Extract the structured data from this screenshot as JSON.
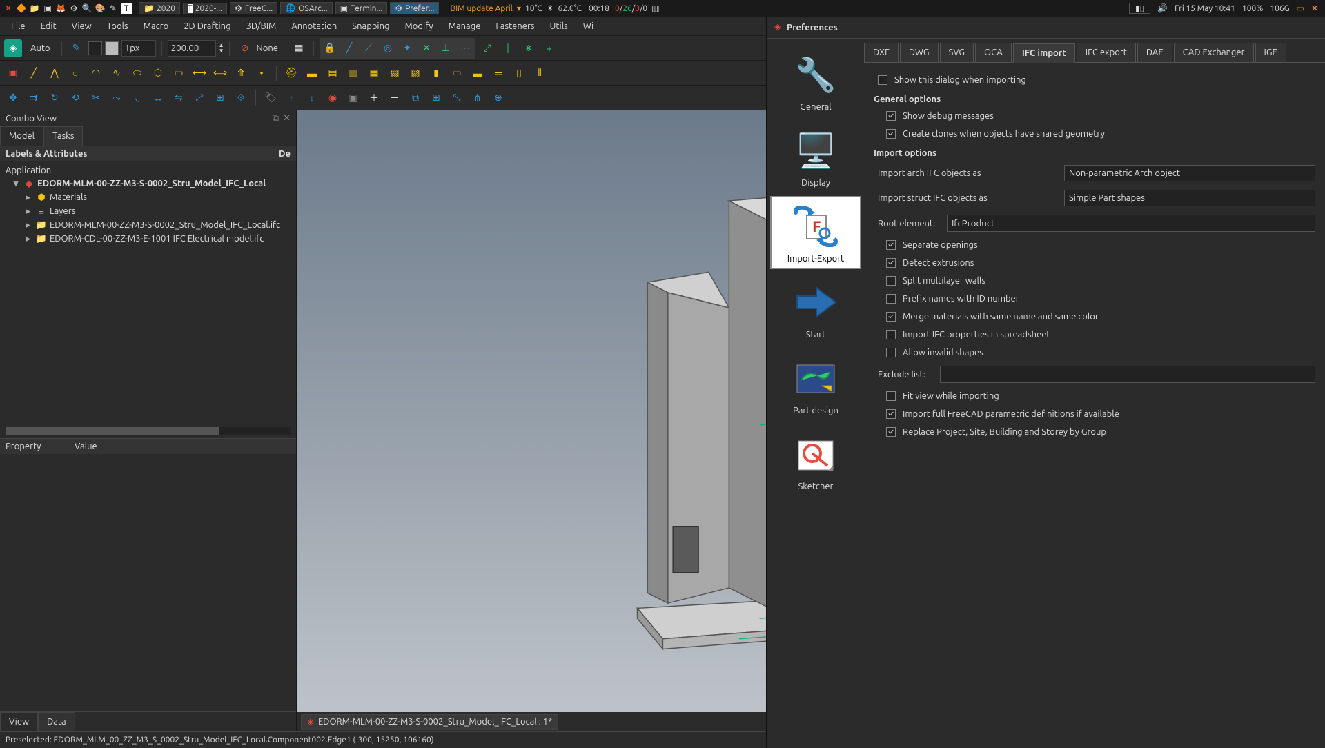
{
  "os_panel": {
    "tasks": [
      {
        "icon": "📁",
        "label": "2020"
      },
      {
        "icon": "📝",
        "label": "2020-..."
      },
      {
        "icon": "⚙",
        "label": "FreeC..."
      },
      {
        "icon": "🌐",
        "label": "OSArc..."
      },
      {
        "icon": "▣",
        "label": "Termin..."
      },
      {
        "icon": "⚙",
        "label": "Prefer...",
        "active": true
      }
    ],
    "bim_update": "BIM update April",
    "temp1": "10°C",
    "temp2": "62.0°C",
    "uptime": "00:18",
    "net": "0/26/0/0",
    "datetime": "Fri 15 May 10:41",
    "battery": "100%",
    "mem": "106G"
  },
  "menubar": [
    "File",
    "Edit",
    "View",
    "Tools",
    "Macro",
    "2D Drafting",
    "3D/BIM",
    "Annotation",
    "Snapping",
    "Modify",
    "Manage",
    "Fasteners",
    "Utils",
    "Wi"
  ],
  "toolbar1": {
    "auto": "Auto",
    "px": "1px",
    "len": "200.00",
    "none": "None"
  },
  "combo": {
    "title": "Combo View",
    "tabs": [
      "Model",
      "Tasks"
    ],
    "tree_headers": [
      "Labels & Attributes",
      "De"
    ],
    "app_label": "Application",
    "root": "EDORM-MLM-00-ZZ-M3-S-0002_Stru_Model_IFC_Local",
    "children": [
      {
        "icon": "materials",
        "label": "Materials"
      },
      {
        "icon": "layers",
        "label": "Layers"
      },
      {
        "icon": "folder",
        "label": "EDORM-MLM-00-ZZ-M3-S-0002_Stru_Model_IFC_Local.ifc"
      },
      {
        "icon": "folder",
        "label": "EDORM-CDL-00-ZZ-M3-E-1001 IFC Electrical model.ifc"
      }
    ],
    "prop_headers": [
      "Property",
      "Value"
    ],
    "bottom_tabs": [
      "View",
      "Data"
    ]
  },
  "doc_tab": "EDORM-MLM-00-ZZ-M3-S-0002_Stru_Model_IFC_Local : 1*",
  "statusbar": "Preselected: EDORM_MLM_00_ZZ_M3_S_0002_Stru_Model_IFC_Local.Component002.Edge1 (-300, 15250, 106160)",
  "prefs": {
    "title": "Preferences",
    "categories": [
      "General",
      "Display",
      "Import-Export",
      "Start",
      "Part design",
      "Sketcher"
    ],
    "active_category": "Import-Export",
    "tabs": [
      "DXF",
      "DWG",
      "SVG",
      "OCA",
      "IFC import",
      "IFC export",
      "DAE",
      "CAD Exchanger",
      "IGE"
    ],
    "active_tab": "IFC import",
    "show_dialog": "Show this dialog when importing",
    "section_general": "General options",
    "show_debug": "Show debug messages",
    "create_clones": "Create clones when objects have shared geometry",
    "section_import": "Import options",
    "import_arch_label": "Import arch IFC objects as",
    "import_arch_value": "Non-parametric Arch object",
    "import_struct_label": "Import struct IFC objects as",
    "import_struct_value": "Simple Part shapes",
    "root_element_label": "Root element:",
    "root_element_value": "IfcProduct",
    "separate_openings": "Separate openings",
    "detect_extrusions": "Detect extrusions",
    "split_walls": "Split multilayer walls",
    "prefix_names": "Prefix names with ID number",
    "merge_materials": "Merge materials with same name and same color",
    "import_props": "Import IFC properties in spreadsheet",
    "allow_invalid": "Allow invalid shapes",
    "exclude_list_label": "Exclude list:",
    "exclude_list_value": "",
    "fit_view": "Fit view while importing",
    "import_parametric": "Import full FreeCAD parametric definitions if available",
    "replace_project": "Replace Project, Site, Building and Storey by Group"
  }
}
